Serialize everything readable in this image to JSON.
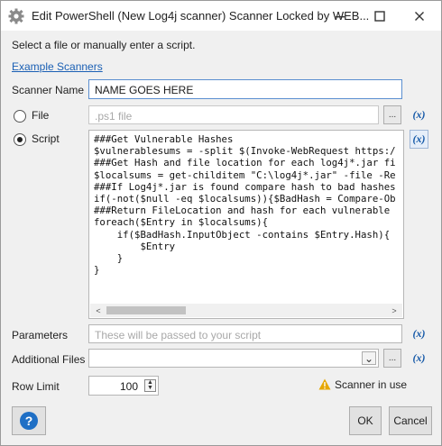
{
  "window": {
    "title": "Edit PowerShell (New Log4j scanner) Scanner Locked by WEB...",
    "controls": {
      "minimize": "–",
      "maximize": "☐",
      "close": "✕"
    }
  },
  "header": {
    "hint": "Select a file or manually enter a script.",
    "example_link": "Example Scanners"
  },
  "scanner_name": {
    "label": "Scanner Name",
    "value": "NAME GOES HERE"
  },
  "file": {
    "label": "File",
    "placeholder": ".ps1 file",
    "browse": "...",
    "fx": "(x)",
    "selected": false
  },
  "script": {
    "label": "Script",
    "selected": true,
    "fx": "(x)",
    "lines": [
      "###Get Vulnerable Hashes",
      "$vulnerablesums = -split $(Invoke-WebRequest https:/",
      "###Get Hash and file location for each log4j*.jar fi",
      "$localsums = get-childitem \"C:\\log4j*.jar\" -file -Re",
      "###If Log4j*.jar is found compare hash to bad hashes",
      "if(-not($null -eq $localsums)){$BadHash = Compare-Ob",
      "###Return FileLocation and hash for each vulnerable ",
      "foreach($Entry in $localsums){",
      "    if($BadHash.InputObject -contains $Entry.Hash){",
      "        $Entry",
      "    }",
      "}"
    ],
    "scroll_left": "<",
    "scroll_right": ">"
  },
  "parameters": {
    "label": "Parameters",
    "placeholder": "These will be passed to your script",
    "fx": "(x)"
  },
  "additional_files": {
    "label": "Additional Files",
    "value": "",
    "dropdown": "⌄",
    "browse": "...",
    "fx": "(x)"
  },
  "row_limit": {
    "label": "Row Limit",
    "value": "100"
  },
  "warning": {
    "text": "Scanner in use",
    "color": "#e6a700"
  },
  "footer": {
    "help": "?",
    "ok": "OK",
    "cancel": "Cancel"
  },
  "colors": {
    "accent": "#1559a8",
    "help": "#1f6fc5",
    "link": "#1a5fb4"
  }
}
